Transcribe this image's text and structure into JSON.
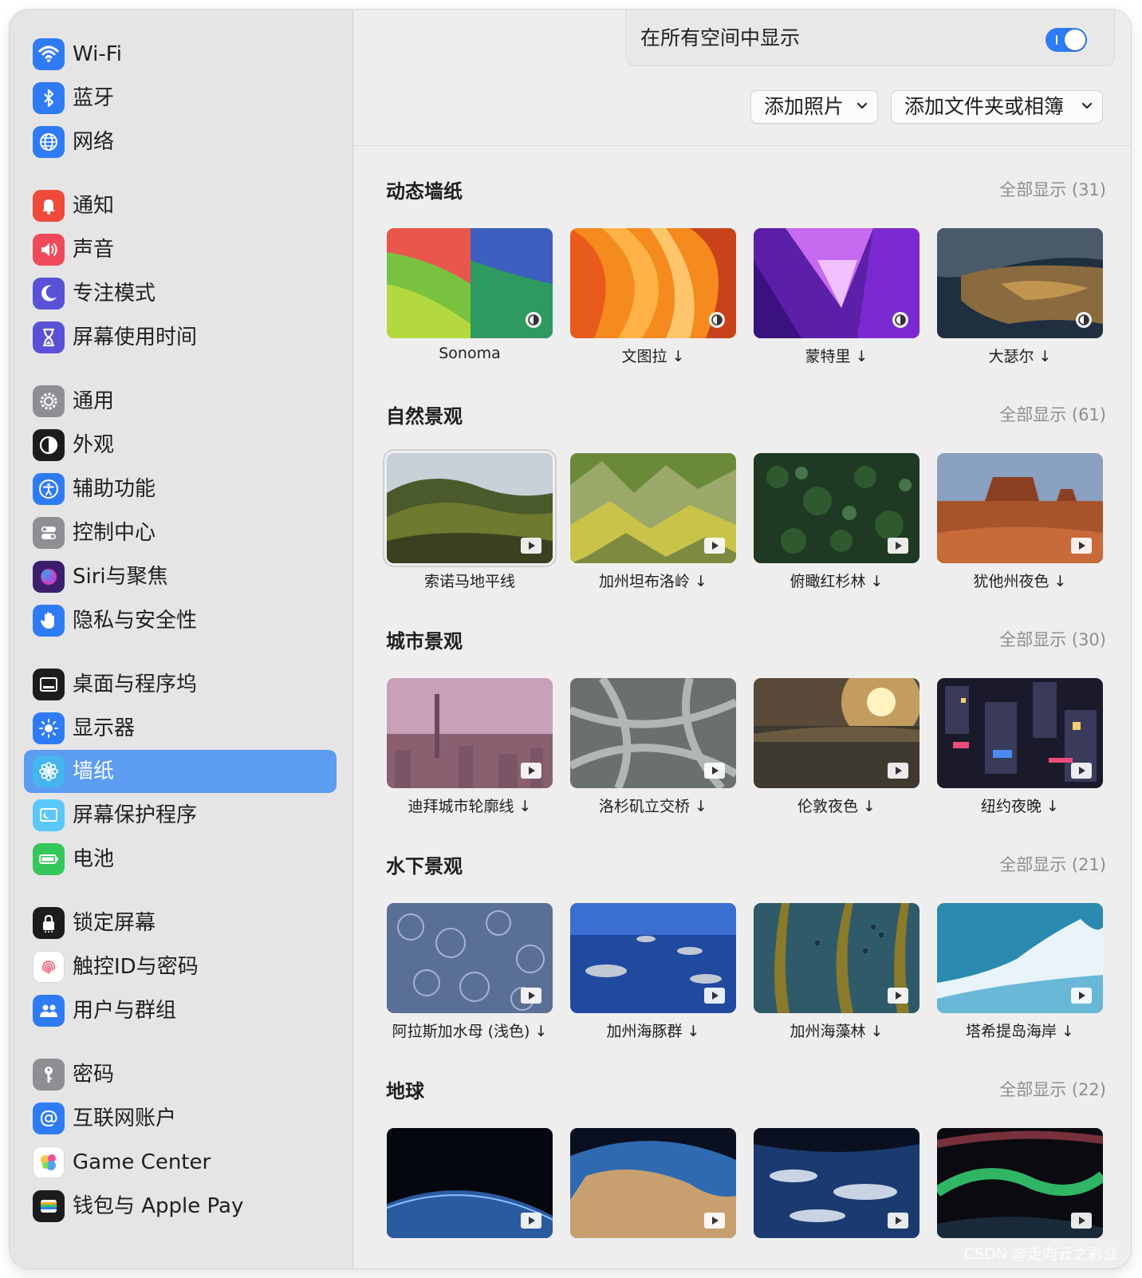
{
  "sidebar": {
    "items": [
      {
        "label": "Wi-Fi",
        "icon": "wifi-icon",
        "color": "#2f7bf5"
      },
      {
        "label": "蓝牙",
        "icon": "bluetooth-icon",
        "color": "#2f7bf5"
      },
      {
        "label": "网络",
        "icon": "globe-icon",
        "color": "#2f7bf5"
      },
      {
        "label": "通知",
        "icon": "bell-icon",
        "color": "#ef4a3c"
      },
      {
        "label": "声音",
        "icon": "speaker-icon",
        "color": "#ef4a5a"
      },
      {
        "label": "专注模式",
        "icon": "moon-icon",
        "color": "#5a52d6"
      },
      {
        "label": "屏幕使用时间",
        "icon": "hourglass-icon",
        "color": "#5a52d6"
      },
      {
        "label": "通用",
        "icon": "gear-icon",
        "color": "#8e8e93"
      },
      {
        "label": "外观",
        "icon": "appearance-icon",
        "color": "#1c1c1e"
      },
      {
        "label": "辅助功能",
        "icon": "accessibility-icon",
        "color": "#2f7bf5"
      },
      {
        "label": "控制中心",
        "icon": "toggles-icon",
        "color": "#8e8e93"
      },
      {
        "label": "Siri与聚焦",
        "icon": "siri-icon",
        "color": "#3b1f6e"
      },
      {
        "label": "隐私与安全性",
        "icon": "hand-icon",
        "color": "#2f7bf5"
      },
      {
        "label": "桌面与程序坞",
        "icon": "dock-icon",
        "color": "#1c1c1e"
      },
      {
        "label": "显示器",
        "icon": "sun-icon",
        "color": "#2f7bf5"
      },
      {
        "label": "墙纸",
        "icon": "flower-icon",
        "color": "#45b5f0"
      },
      {
        "label": "屏幕保护程序",
        "icon": "screensaver-icon",
        "color": "#5ac8fa"
      },
      {
        "label": "电池",
        "icon": "battery-icon",
        "color": "#34c759"
      },
      {
        "label": "锁定屏幕",
        "icon": "lock-icon",
        "color": "#1c1c1e"
      },
      {
        "label": "触控ID与密码",
        "icon": "fingerprint-icon",
        "color": "#ffffff"
      },
      {
        "label": "用户与群组",
        "icon": "users-icon",
        "color": "#2f7bf5"
      },
      {
        "label": "密码",
        "icon": "key-icon",
        "color": "#8e8e93"
      },
      {
        "label": "互联网账户",
        "icon": "at-icon",
        "color": "#2f7bf5"
      },
      {
        "label": "Game Center",
        "icon": "game-center-icon",
        "color": "#ffffff"
      },
      {
        "label": "钱包与 Apple Pay",
        "icon": "wallet-icon",
        "color": "#1c1c1e"
      }
    ],
    "active_index": 15,
    "active_color": "#5c9cf1"
  },
  "header": {
    "toggle_label": "在所有空间中显示",
    "toggle_on": true,
    "toggle_color": "#2f7bf5",
    "add_photo_label": "添加照片",
    "add_folder_label": "添加文件夹或相簿"
  },
  "sections": [
    {
      "title": "动态墙纸",
      "show_all": "全部显示 (31)",
      "badge": "dynamic-icon",
      "items": [
        {
          "caption": "Sonoma",
          "selected": false
        },
        {
          "caption": "文图拉 ↓",
          "selected": false
        },
        {
          "caption": "蒙特里 ↓",
          "selected": false
        },
        {
          "caption": "大瑟尔 ↓",
          "selected": false
        }
      ]
    },
    {
      "title": "自然景观",
      "show_all": "全部显示 (61)",
      "badge": "play-icon",
      "items": [
        {
          "caption": "索诺马地平线",
          "selected": true
        },
        {
          "caption": "加州坦布洛岭 ↓",
          "selected": false
        },
        {
          "caption": "俯瞰红杉林 ↓",
          "selected": false
        },
        {
          "caption": "犹他州夜色 ↓",
          "selected": false
        }
      ]
    },
    {
      "title": "城市景观",
      "show_all": "全部显示 (30)",
      "badge": "play-icon",
      "items": [
        {
          "caption": "迪拜城市轮廓线 ↓",
          "selected": false
        },
        {
          "caption": "洛杉矶立交桥 ↓",
          "selected": false
        },
        {
          "caption": "伦敦夜色 ↓",
          "selected": false
        },
        {
          "caption": "纽约夜晚 ↓",
          "selected": false
        }
      ]
    },
    {
      "title": "水下景观",
      "show_all": "全部显示 (21)",
      "badge": "play-icon",
      "items": [
        {
          "caption": "阿拉斯加水母 (浅色) ↓",
          "selected": false
        },
        {
          "caption": "加州海豚群 ↓",
          "selected": false
        },
        {
          "caption": "加州海藻林 ↓",
          "selected": false
        },
        {
          "caption": "塔希提岛海岸 ↓",
          "selected": false
        }
      ]
    },
    {
      "title": "地球",
      "show_all": "全部显示 (22)",
      "badge": "play-icon",
      "items": [
        {
          "caption": "",
          "selected": false
        },
        {
          "caption": "",
          "selected": false
        },
        {
          "caption": "",
          "selected": false
        },
        {
          "caption": "",
          "selected": false
        }
      ]
    }
  ],
  "watermark": "CSDN @走向云之彩业"
}
